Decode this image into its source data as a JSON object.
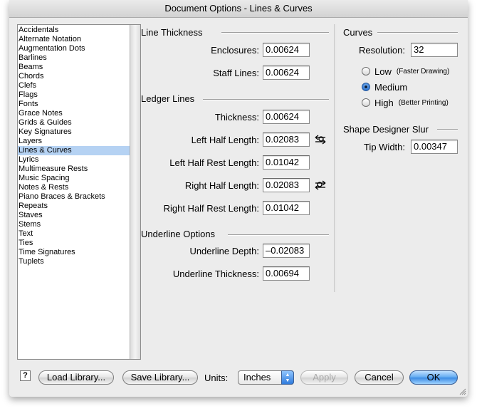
{
  "window": {
    "title": "Document Options - Lines & Curves"
  },
  "sidebar": {
    "items": [
      {
        "label": "Accidentals"
      },
      {
        "label": "Alternate Notation"
      },
      {
        "label": "Augmentation Dots"
      },
      {
        "label": "Barlines"
      },
      {
        "label": "Beams"
      },
      {
        "label": "Chords"
      },
      {
        "label": "Clefs"
      },
      {
        "label": "Flags"
      },
      {
        "label": "Fonts"
      },
      {
        "label": "Grace Notes"
      },
      {
        "label": "Grids & Guides"
      },
      {
        "label": "Key Signatures"
      },
      {
        "label": "Layers"
      },
      {
        "label": "Lines & Curves",
        "selected": true
      },
      {
        "label": "Lyrics"
      },
      {
        "label": "Multimeasure Rests"
      },
      {
        "label": "Music Spacing"
      },
      {
        "label": "Notes & Rests"
      },
      {
        "label": "Piano Braces & Brackets"
      },
      {
        "label": "Repeats"
      },
      {
        "label": "Staves"
      },
      {
        "label": "Stems"
      },
      {
        "label": "Text"
      },
      {
        "label": "Ties"
      },
      {
        "label": "Time Signatures"
      },
      {
        "label": "Tuplets"
      }
    ]
  },
  "line_thickness": {
    "title": "Line Thickness",
    "enclosures": {
      "label": "Enclosures:",
      "value": "0.00624"
    },
    "staff_lines": {
      "label": "Staff Lines:",
      "value": "0.00624"
    }
  },
  "ledger_lines": {
    "title": "Ledger Lines",
    "thickness": {
      "label": "Thickness:",
      "value": "0.00624"
    },
    "left_half_length": {
      "label": "Left Half Length:",
      "value": "0.02083"
    },
    "left_half_rest_length": {
      "label": "Left Half Rest Length:",
      "value": "0.01042"
    },
    "right_half_length": {
      "label": "Right Half Length:",
      "value": "0.02083"
    },
    "right_half_rest_length": {
      "label": "Right Half Rest Length:",
      "value": "0.01042"
    }
  },
  "underline_options": {
    "title": "Underline Options",
    "depth": {
      "label": "Underline Depth:",
      "value": "–0.02083"
    },
    "thickness": {
      "label": "Underline Thickness:",
      "value": "0.00694"
    }
  },
  "curves": {
    "title": "Curves",
    "resolution": {
      "label": "Resolution:",
      "value": "32"
    },
    "options": [
      {
        "label": "Low",
        "hint": "(Faster Drawing)",
        "checked": false
      },
      {
        "label": "Medium",
        "hint": "",
        "checked": true
      },
      {
        "label": "High",
        "hint": "(Better Printing)",
        "checked": false
      }
    ]
  },
  "shape_designer_slur": {
    "title": "Shape Designer Slur",
    "tip_width": {
      "label": "Tip Width:",
      "value": "0.00347"
    }
  },
  "footer": {
    "help": "?",
    "load_library": "Load Library...",
    "save_library": "Save Library...",
    "units_label": "Units:",
    "units_value": "Inches",
    "apply": "Apply",
    "cancel": "Cancel",
    "ok": "OK"
  },
  "icons": {
    "link_left": "link-arrows-icon",
    "link_right": "link-arrows-icon",
    "popup": "up-down-arrows-icon",
    "resize": "resize-grip-icon"
  },
  "colors": {
    "selection": "#b5d2f3",
    "default_button": "#3a8ae3",
    "window_background": "#ececec"
  }
}
